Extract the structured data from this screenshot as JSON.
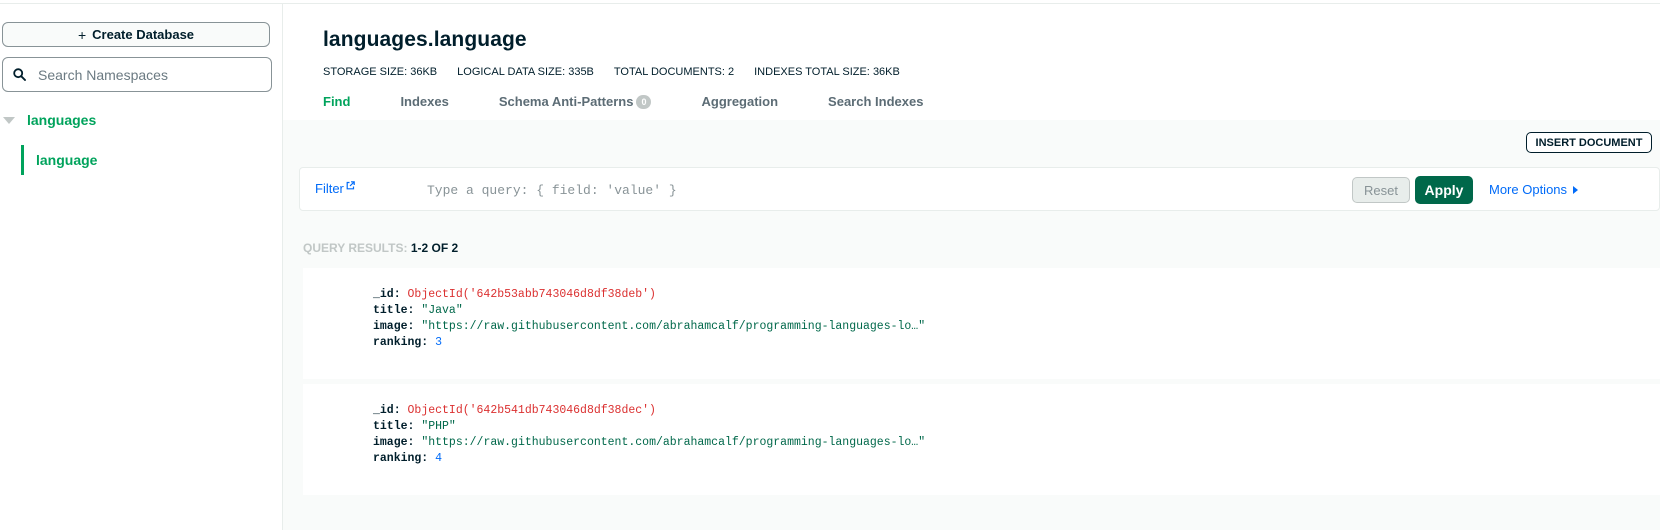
{
  "sidebar": {
    "create_db_label": "Create Database",
    "search_placeholder": "Search Namespaces",
    "database": "languages",
    "collection": "language"
  },
  "header": {
    "namespace": "languages.language",
    "stats": [
      {
        "label": "STORAGE SIZE:",
        "value": "36KB"
      },
      {
        "label": "LOGICAL DATA SIZE:",
        "value": "335B"
      },
      {
        "label": "TOTAL DOCUMENTS:",
        "value": "2"
      },
      {
        "label": "INDEXES TOTAL SIZE:",
        "value": "36KB"
      }
    ],
    "tabs": [
      {
        "label": "Find",
        "active": true
      },
      {
        "label": "Indexes"
      },
      {
        "label": "Schema Anti-Patterns",
        "badge": "0"
      },
      {
        "label": "Aggregation"
      },
      {
        "label": "Search Indexes"
      }
    ]
  },
  "toolbar": {
    "insert_label": "INSERT DOCUMENT",
    "filter_label": "Filter",
    "query_placeholder": "Type a query: { field: 'value' }",
    "reset_label": "Reset",
    "apply_label": "Apply",
    "more_options_label": "More Options"
  },
  "results": {
    "label": "QUERY RESULTS:",
    "count": "1-2 OF 2",
    "documents": [
      {
        "_id": "ObjectId('642b53abb743046d8df38deb')",
        "title": "\"Java\"",
        "image": "\"https://raw.githubusercontent.com/abrahamcalf/programming-languages-lo…\"",
        "ranking": "3"
      },
      {
        "_id": "ObjectId('642b541db743046d8df38dec')",
        "title": "\"PHP\"",
        "image": "\"https://raw.githubusercontent.com/abrahamcalf/programming-languages-lo…\"",
        "ranking": "4"
      }
    ]
  },
  "fields": {
    "id_key": "_id:",
    "title_key": "title:",
    "image_key": "image:",
    "ranking_key": "ranking:"
  },
  "colors": {
    "brand_green": "#00a35c",
    "apply_green": "#00684a",
    "link_blue": "#016bf8",
    "objectid_red": "#db3030"
  }
}
